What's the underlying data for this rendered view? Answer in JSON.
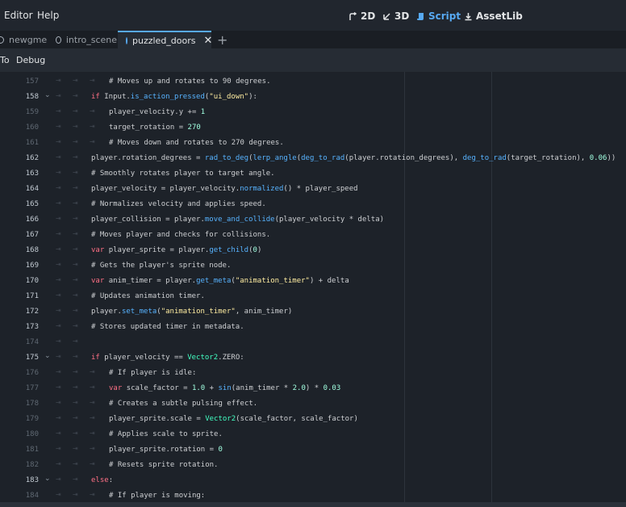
{
  "menu": {
    "editor": "Editor",
    "help": "Help"
  },
  "workspaces": [
    {
      "label": "2D",
      "active": false
    },
    {
      "label": "3D",
      "active": false
    },
    {
      "label": "Script",
      "active": true
    },
    {
      "label": "AssetLib",
      "active": false
    }
  ],
  "tabs": [
    {
      "label": "newgme"
    },
    {
      "label": "intro_scene"
    },
    {
      "label": "puzzled_doors",
      "active": true
    }
  ],
  "toolbar": {
    "goto": "To",
    "debug": "Debug"
  },
  "colors": {
    "accent": "#57a9f2",
    "keyword": "#ff7085",
    "function": "#57b3ff",
    "string": "#ffeda1",
    "number": "#a1ffe0",
    "class": "#42ffc2",
    "comment": "#7e8790"
  },
  "lines": [
    {
      "num": "157",
      "indent": 2,
      "fold": false,
      "tokens": [
        [
          "c",
          "# Moves up and rotates to 90 degrees."
        ]
      ]
    },
    {
      "num": "158",
      "indent": 1,
      "fold": true,
      "tokens": [
        [
          "k",
          "if "
        ],
        [
          "t",
          "Input."
        ],
        [
          "f",
          "is_action_pressed"
        ],
        [
          "t",
          "("
        ],
        [
          "s",
          "\"ui_down\""
        ],
        [
          "t",
          "):"
        ]
      ]
    },
    {
      "num": "159",
      "indent": 2,
      "fold": false,
      "tokens": [
        [
          "t",
          "player_velocity.y += "
        ],
        [
          "n",
          "1"
        ]
      ]
    },
    {
      "num": "160",
      "indent": 2,
      "fold": false,
      "tokens": [
        [
          "t",
          "target_rotation = "
        ],
        [
          "n",
          "270"
        ]
      ]
    },
    {
      "num": "161",
      "indent": 2,
      "fold": false,
      "tokens": [
        [
          "c",
          "# Moves down and rotates to 270 degrees."
        ]
      ]
    },
    {
      "num": "162",
      "indent": 1,
      "fold": false,
      "tokens": [
        [
          "t",
          "player.rotation_degrees = "
        ],
        [
          "f",
          "rad_to_deg"
        ],
        [
          "t",
          "("
        ],
        [
          "f",
          "lerp_angle"
        ],
        [
          "t",
          "("
        ],
        [
          "f",
          "deg_to_rad"
        ],
        [
          "t",
          "(player.rotation_degrees), "
        ],
        [
          "f",
          "deg_to_rad"
        ],
        [
          "t",
          "(target_rotation), "
        ],
        [
          "n",
          "0.06"
        ],
        [
          "t",
          "))"
        ]
      ]
    },
    {
      "num": "163",
      "indent": 1,
      "fold": false,
      "tokens": [
        [
          "c",
          "# Smoothly rotates player to target angle."
        ]
      ]
    },
    {
      "num": "164",
      "indent": 1,
      "fold": false,
      "tokens": [
        [
          "t",
          "player_velocity = player_velocity."
        ],
        [
          "f",
          "normalized"
        ],
        [
          "t",
          "() * player_speed"
        ]
      ]
    },
    {
      "num": "165",
      "indent": 1,
      "fold": false,
      "tokens": [
        [
          "c",
          "# Normalizes velocity and applies speed."
        ]
      ]
    },
    {
      "num": "166",
      "indent": 1,
      "fold": false,
      "tokens": [
        [
          "t",
          "player_collision = player."
        ],
        [
          "f",
          "move_and_collide"
        ],
        [
          "t",
          "(player_velocity * delta)"
        ]
      ]
    },
    {
      "num": "167",
      "indent": 1,
      "fold": false,
      "tokens": [
        [
          "c",
          "# Moves player and checks for collisions."
        ]
      ]
    },
    {
      "num": "168",
      "indent": 1,
      "fold": false,
      "tokens": [
        [
          "k",
          "var "
        ],
        [
          "t",
          "player_sprite = player."
        ],
        [
          "f",
          "get_child"
        ],
        [
          "t",
          "("
        ],
        [
          "n",
          "0"
        ],
        [
          "t",
          ")"
        ]
      ]
    },
    {
      "num": "169",
      "indent": 1,
      "fold": false,
      "tokens": [
        [
          "c",
          "# Gets the player's sprite node."
        ]
      ]
    },
    {
      "num": "170",
      "indent": 1,
      "fold": false,
      "tokens": [
        [
          "k",
          "var "
        ],
        [
          "t",
          "anim_timer = player."
        ],
        [
          "f",
          "get_meta"
        ],
        [
          "t",
          "("
        ],
        [
          "s",
          "\"animation_timer\""
        ],
        [
          "t",
          ") + delta"
        ]
      ]
    },
    {
      "num": "171",
      "indent": 1,
      "fold": false,
      "tokens": [
        [
          "c",
          "# Updates animation timer."
        ]
      ]
    },
    {
      "num": "172",
      "indent": 1,
      "fold": false,
      "tokens": [
        [
          "t",
          "player."
        ],
        [
          "f",
          "set_meta"
        ],
        [
          "t",
          "("
        ],
        [
          "s",
          "\"animation_timer\""
        ],
        [
          "t",
          ", anim_timer)"
        ]
      ]
    },
    {
      "num": "173",
      "indent": 1,
      "fold": false,
      "tokens": [
        [
          "c",
          "# Stores updated timer in metadata."
        ]
      ]
    },
    {
      "num": "174",
      "indent": 0,
      "fold": false,
      "tokens": []
    },
    {
      "num": "175",
      "indent": 1,
      "fold": true,
      "tokens": [
        [
          "k",
          "if "
        ],
        [
          "t",
          "player_velocity == "
        ],
        [
          "l",
          "Vector2"
        ],
        [
          "t",
          ".ZERO:"
        ]
      ]
    },
    {
      "num": "176",
      "indent": 2,
      "fold": false,
      "tokens": [
        [
          "c",
          "# If player is idle:"
        ]
      ]
    },
    {
      "num": "177",
      "indent": 2,
      "fold": false,
      "tokens": [
        [
          "k",
          "var "
        ],
        [
          "t",
          "scale_factor = "
        ],
        [
          "n",
          "1.0"
        ],
        [
          "t",
          " + "
        ],
        [
          "f",
          "sin"
        ],
        [
          "t",
          "(anim_timer * "
        ],
        [
          "n",
          "2.0"
        ],
        [
          "t",
          ") * "
        ],
        [
          "n",
          "0.03"
        ]
      ]
    },
    {
      "num": "178",
      "indent": 2,
      "fold": false,
      "tokens": [
        [
          "c",
          "# Creates a subtle pulsing effect."
        ]
      ]
    },
    {
      "num": "179",
      "indent": 2,
      "fold": false,
      "tokens": [
        [
          "t",
          "player_sprite.scale = "
        ],
        [
          "l",
          "Vector2"
        ],
        [
          "t",
          "(scale_factor, scale_factor)"
        ]
      ]
    },
    {
      "num": "180",
      "indent": 2,
      "fold": false,
      "tokens": [
        [
          "c",
          "# Applies scale to sprite."
        ]
      ]
    },
    {
      "num": "181",
      "indent": 2,
      "fold": false,
      "tokens": [
        [
          "t",
          "player_sprite.rotation = "
        ],
        [
          "n",
          "0"
        ]
      ]
    },
    {
      "num": "182",
      "indent": 2,
      "fold": false,
      "tokens": [
        [
          "c",
          "# Resets sprite rotation."
        ]
      ]
    },
    {
      "num": "183",
      "indent": 1,
      "fold": true,
      "tokens": [
        [
          "k",
          "else"
        ],
        [
          "t",
          ":"
        ]
      ]
    },
    {
      "num": "184",
      "indent": 2,
      "fold": false,
      "tokens": [
        [
          "c",
          "# If player is moving:"
        ]
      ]
    }
  ]
}
